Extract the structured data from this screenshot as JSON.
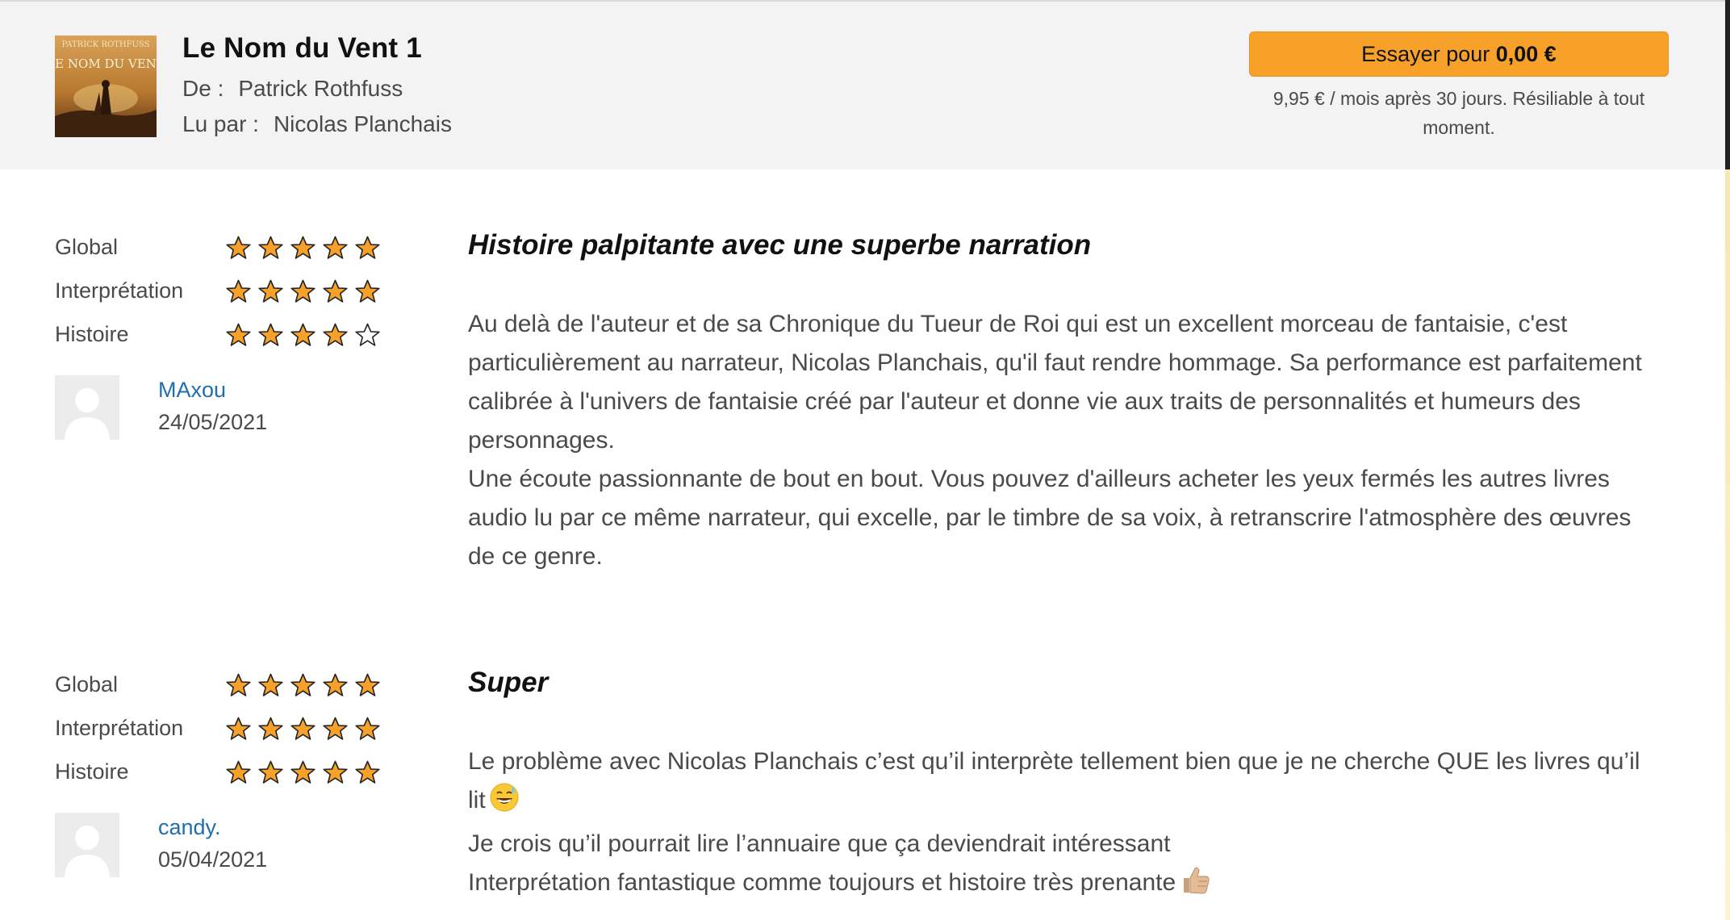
{
  "header": {
    "cover_text": {
      "author": "PATRICK ROTHFUSS",
      "title": "LE NOM DU VENT"
    },
    "title": "Le Nom du Vent 1",
    "author_label": "De :",
    "author_value": "Patrick Rothfuss",
    "narrator_label": "Lu par :",
    "narrator_value": "Nicolas Planchais",
    "cta": {
      "label": "Essayer pour",
      "price": "0,00 €",
      "note": "9,95 € / mois après 30 jours. Résiliable à tout moment."
    }
  },
  "colors": {
    "accent": "#f7a12b",
    "link": "#1f6fb0",
    "header_bg": "#f2f3f2"
  },
  "icons": {
    "star_filled": "star-filled-icon",
    "star_empty": "star-empty-icon",
    "avatar": "user-avatar-placeholder-icon",
    "emoji_1": "grinning-sweat-emoji",
    "emoji_2": "thumbs-up-emoji"
  },
  "reviews": [
    {
      "ratings": [
        {
          "label": "Global",
          "stars": 5,
          "max": 5
        },
        {
          "label": "Interprétation",
          "stars": 5,
          "max": 5
        },
        {
          "label": "Histoire",
          "stars": 4,
          "max": 5
        }
      ],
      "reviewer": "MAxou",
      "date": "24/05/2021",
      "title": "Histoire palpitante avec une superbe narration",
      "paragraphs": [
        "Au delà de l'auteur et de sa Chronique du Tueur de Roi qui est un excellent morceau de fantaisie, c'est particulièrement au narrateur, Nicolas Planchais, qu'il faut rendre hommage. Sa performance est parfaitement calibrée à l'univers de fantaisie créé par l'auteur et donne vie aux traits de personnalités et humeurs des personnages.",
        "Une écoute passionnante de bout en bout. Vous pouvez d'ailleurs acheter les yeux fermés les autres livres audio lu par ce même narrateur, qui excelle, par le timbre de sa voix, à retranscrire l'atmosphère des œuvres de ce genre."
      ]
    },
    {
      "ratings": [
        {
          "label": "Global",
          "stars": 5,
          "max": 5
        },
        {
          "label": "Interprétation",
          "stars": 5,
          "max": 5
        },
        {
          "label": "Histoire",
          "stars": 5,
          "max": 5
        }
      ],
      "reviewer": "candy.",
      "date": "05/04/2021",
      "title": "Super",
      "paragraphs": [
        "Le problème avec Nicolas Planchais c’est qu’il interprète tellement bien que je ne cherche QUE les livres qu’il lit",
        "Je crois qu’il pourrait lire l’annuaire que ça deviendrait intéressant",
        "Interprétation fantastique comme toujours et histoire très prenante"
      ]
    }
  ]
}
